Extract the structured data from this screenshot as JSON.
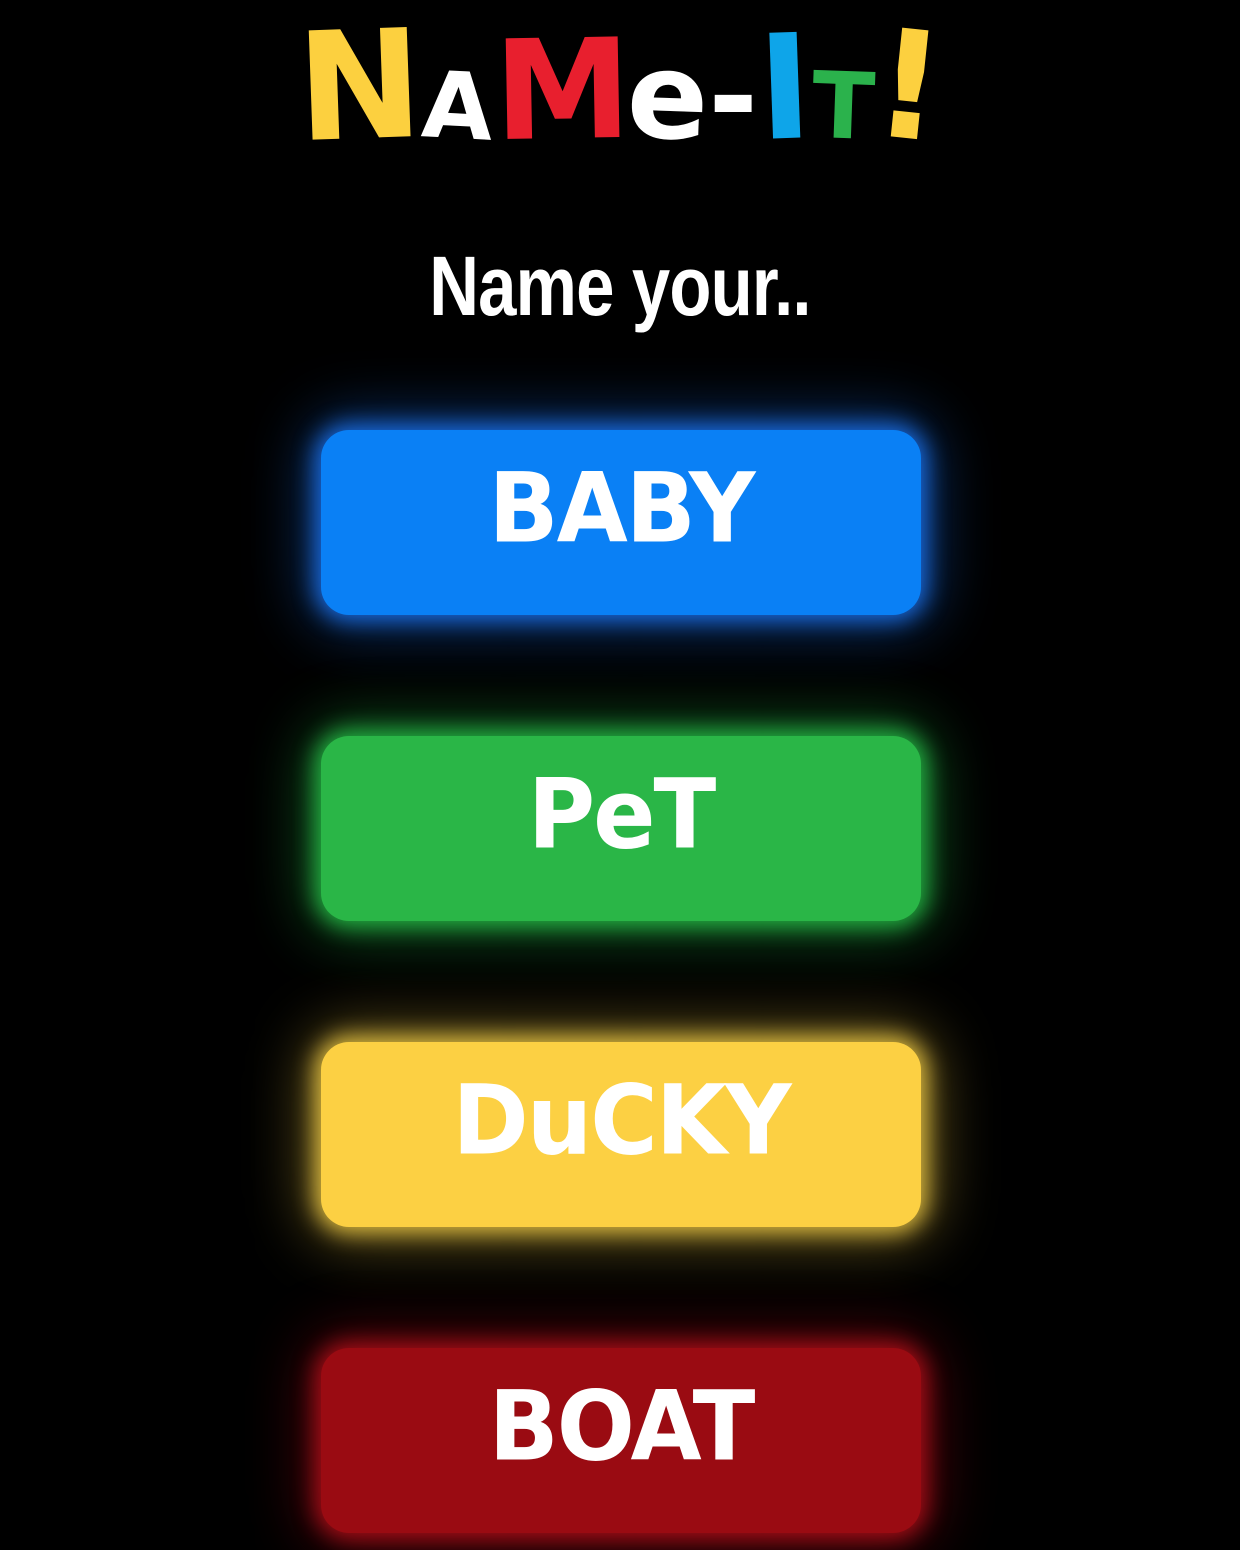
{
  "logo": {
    "letters": [
      {
        "char": "N",
        "color": "#FCD03F"
      },
      {
        "char": "A",
        "color": "#FFFFFF"
      },
      {
        "char": "M",
        "color": "#E81F2E"
      },
      {
        "char": "e",
        "color": "#FFFFFF"
      },
      {
        "char": "-",
        "color": "#FFFFFF"
      },
      {
        "char": "I",
        "color": "#0EA5E9"
      },
      {
        "char": "T",
        "color": "#2BB24C"
      },
      {
        "char": "!",
        "color": "#FCD03F"
      }
    ]
  },
  "subtitle": "Name your..",
  "buttons": [
    {
      "label": "BABY",
      "color": "#0A80F5",
      "glow": "#1E7BFF"
    },
    {
      "label": "PeT",
      "color": "#2AB647",
      "glow": "#2BD04F"
    },
    {
      "label": "DuCKY",
      "color": "#FCD043",
      "glow": "#FFD84A"
    },
    {
      "label": "BOAT",
      "color": "#9A0B12",
      "glow": "#C0101C"
    }
  ]
}
